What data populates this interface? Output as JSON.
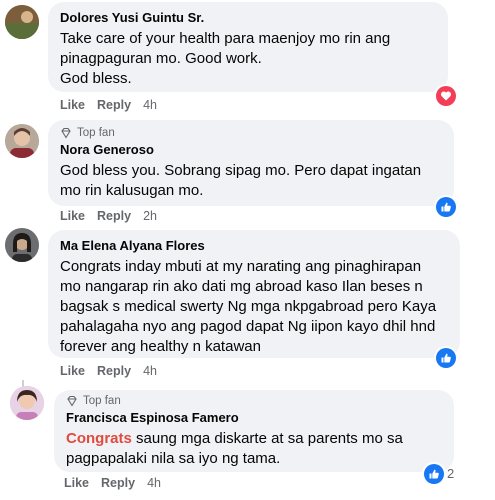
{
  "comments": [
    {
      "name": "Dolores Yusi Guintu Sr.",
      "top_fan": "",
      "lines": [
        "Take care of your health para maenjoy mo rin ang",
        "pinagpaguran mo. Good work.",
        "God bless."
      ],
      "like": "Like",
      "reply": "Reply",
      "time": "4h",
      "reaction": "love-icon",
      "reaction_count": ""
    },
    {
      "name": "Nora Generoso",
      "top_fan": "Top fan",
      "lines": [
        "God bless you. Sobrang sipag mo. Pero dapat ingatan",
        "mo rin kalusugan mo."
      ],
      "like": "Like",
      "reply": "Reply",
      "time": "2h",
      "reaction": "like-icon",
      "reaction_count": ""
    },
    {
      "name": "Ma Elena Alyana Flores",
      "top_fan": "",
      "lines": [
        "Congrats inday mbuti at my narating ang pinaghirapan",
        "mo nangarap rin ako dati mg abroad kaso Ilan beses n",
        "bagsak s medical swerty Ng mga nkpgabroad pero Kaya",
        "pahalagaha nyo ang pagod dapat Ng iipon kayo dhil hnd",
        "forever ang healthy n katawan"
      ],
      "like": "Like",
      "reply": "Reply",
      "time": "4h",
      "reaction": "like-icon",
      "reaction_count": ""
    },
    {
      "name": "Francisca Espinosa Famero",
      "top_fan": "Top fan",
      "highlight": "Congrats",
      "first_rest": " saung mga diskarte at sa parents mo sa",
      "lines": [
        "pagpapalaki nila sa iyo ng tama."
      ],
      "like": "Like",
      "reply": "Reply",
      "time": "4h",
      "reaction": "like-icon",
      "reaction_count": "2"
    }
  ],
  "colors": {
    "like_blue": "#1877f2",
    "love_red": "#f33e58",
    "bubble": "#f0f2f5",
    "meta": "#65676b",
    "highlight": "#e04b3f"
  }
}
